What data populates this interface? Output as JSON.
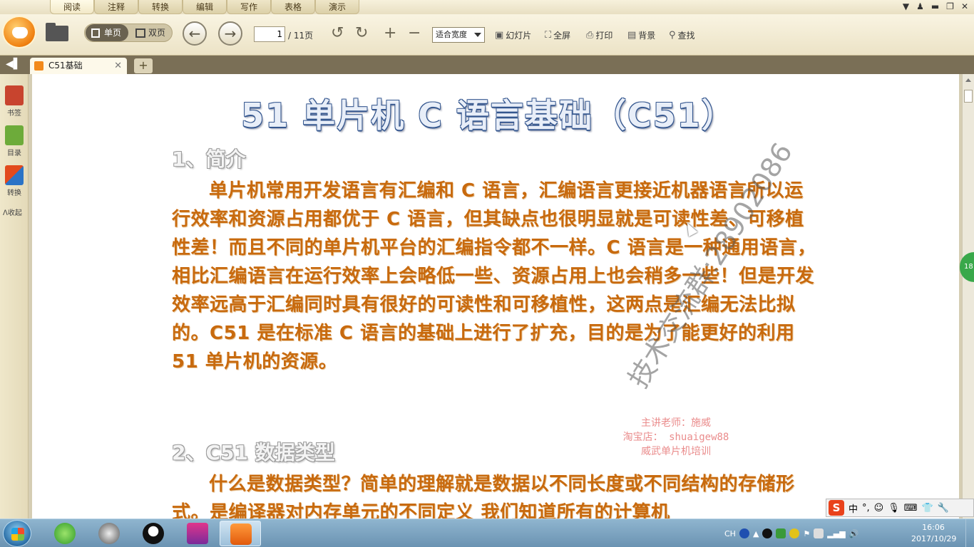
{
  "menubar": {
    "tabs": [
      "阅读",
      "注释",
      "转换",
      "编辑",
      "写作",
      "表格",
      "演示"
    ],
    "active_tab": 0
  },
  "toolbar": {
    "single_page": "单页",
    "double_page": "双页",
    "page_current": "1",
    "page_total": "/ 11页",
    "zoom_mode": "适合宽度",
    "slideshow": "幻灯片",
    "fullscreen": "全屏",
    "print": "打印",
    "background": "背景",
    "find": "查找"
  },
  "tabs": {
    "doc_tab_title": "C51基础"
  },
  "sidebar": {
    "bookmark": "书签",
    "toc": "目录",
    "convert": "转换",
    "collapse": "收起"
  },
  "document": {
    "title": "51 单片机 C 语言基础（C51）",
    "section1_heading": "1、简介",
    "section1_body": "单片机常用开发语言有汇编和 C 语言，汇编语言更接近机器语言所以运行效率和资源占用都优于 C 语言，但其缺点也很明显就是可读性差、可移植性差！而且不同的单片机平台的汇编指令都不一样。C 语言是一种通用语言，相比汇编语言在运行效率上会略低一些、资源占用上也会稍多一些！但是开发效率远高于汇编同时具有很好的可读性和可移植性，这两点是汇编无法比拟的。C51 是在标准 C 语言的基础上进行了扩充，目的是为了能更好的利用 51 单片机的资源。",
    "section2_heading": "2、C51 数据类型",
    "section2_body": "什么是数据类型？简单的理解就是数据以不同长度或不同结构的存储形式。是编译器对内存单元的不同定义 我们知道所有的计算机",
    "watermark": "技术交流群:28902086",
    "stamp_line1": "主讲老师：施威",
    "stamp_line2": "淘宝店： shuaigew88",
    "stamp_line3": "威武单片机培训",
    "float_badge": "18"
  },
  "ime": {
    "mode": "中",
    "punct": "°,"
  },
  "taskbar": {
    "lang": "CH",
    "time": "16:06",
    "date": "2017/10/29"
  },
  "colors": {
    "body_text": "#c86a0e",
    "title_outline": "#35578f",
    "accent_orange": "#f08010"
  }
}
